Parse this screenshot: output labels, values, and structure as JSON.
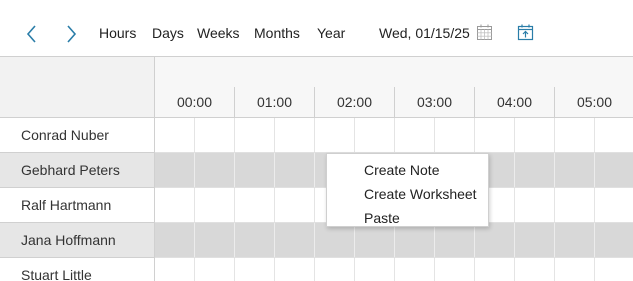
{
  "toolbar": {
    "prev_icon": "chevron-left-icon",
    "next_icon": "chevron-right-icon",
    "views": [
      "Hours",
      "Days",
      "Weeks",
      "Months",
      "Year"
    ],
    "date": "Wed, 01/15/25",
    "calendar_icon": "calendar-icon",
    "today_icon": "calendar-today-icon",
    "accent_color": "#2a7da8"
  },
  "timeline": {
    "hours": [
      "00:00",
      "01:00",
      "02:00",
      "03:00",
      "04:00",
      "05:00"
    ]
  },
  "resources": [
    {
      "name": "Conrad Nuber"
    },
    {
      "name": "Gebhard Peters"
    },
    {
      "name": "Ralf Hartmann"
    },
    {
      "name": "Jana Hoffmann"
    },
    {
      "name": "Stuart Little"
    }
  ],
  "context_menu": {
    "items": [
      "Create Note",
      "Create Worksheet",
      "Paste"
    ]
  }
}
